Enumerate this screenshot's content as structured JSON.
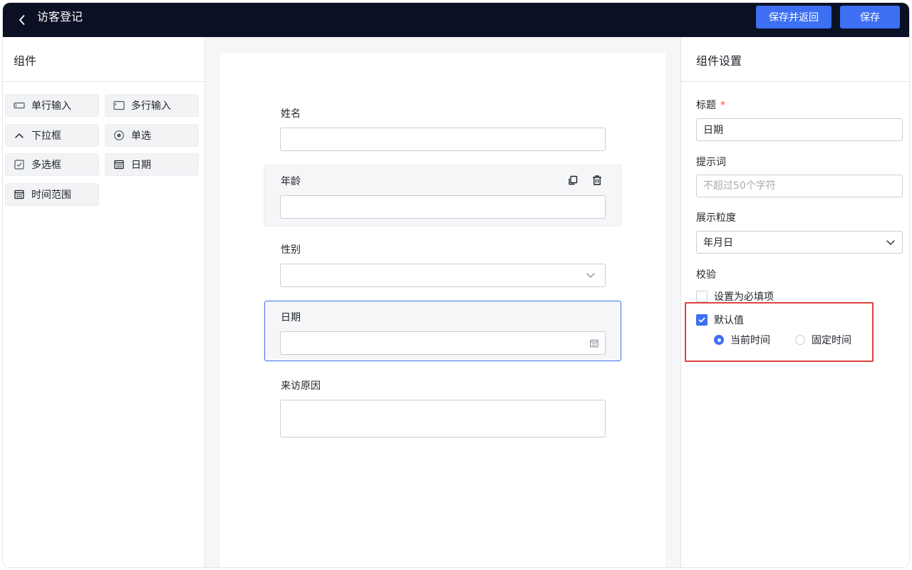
{
  "header": {
    "title": "访客登记",
    "save_return_label": "保存并返回",
    "save_label": "保存"
  },
  "left_panel": {
    "title": "组件",
    "components": [
      {
        "label": "单行输入",
        "icon": "single-line-icon"
      },
      {
        "label": "多行输入",
        "icon": "multi-line-icon"
      },
      {
        "label": "下拉框",
        "icon": "chevron-up-icon"
      },
      {
        "label": "单选",
        "icon": "radio-icon"
      },
      {
        "label": "多选框",
        "icon": "checkbox-icon"
      },
      {
        "label": "日期",
        "icon": "calendar-icon"
      },
      {
        "label": "时间范围",
        "icon": "calendar-icon"
      }
    ]
  },
  "form": {
    "fields": [
      {
        "label": "姓名",
        "type": "text"
      },
      {
        "label": "年龄",
        "type": "text"
      },
      {
        "label": "性别",
        "type": "select"
      },
      {
        "label": "日期",
        "type": "date"
      },
      {
        "label": "来访原因",
        "type": "textarea"
      }
    ]
  },
  "settings": {
    "title": "组件设置",
    "title_label": "标题",
    "required_mark": "*",
    "title_value": "日期",
    "hint_label": "提示词",
    "hint_placeholder": "不超过50个字符",
    "granularity_label": "展示粒度",
    "granularity_value": "年月日",
    "validation_label": "校验",
    "required_checkbox_label": "设置为必填项",
    "required_checked": false,
    "default_checkbox_label": "默认值",
    "default_checked": true,
    "radio_current_label": "当前时间",
    "radio_fixed_label": "固定时间",
    "radio_selected": "当前时间"
  },
  "colors": {
    "header_bg": "#0b1024",
    "accent": "#3d6ff2",
    "highlight": "#e0443e"
  }
}
